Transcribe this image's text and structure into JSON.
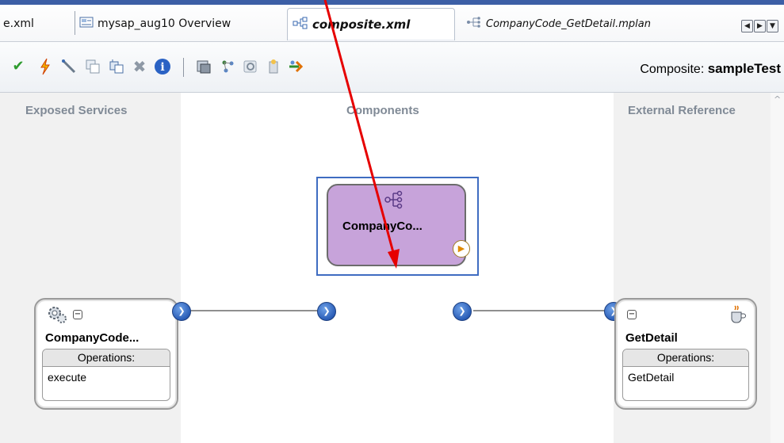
{
  "tabs": [
    {
      "label": "e.xml",
      "icon": "xml-file-icon"
    },
    {
      "label": "mysap_aug10 Overview",
      "icon": "overview-icon"
    },
    {
      "label": "composite.xml",
      "icon": "composite-icon",
      "active": true
    },
    {
      "label": "CompanyCode_GetDetail.mplan",
      "icon": "mplan-icon"
    }
  ],
  "toolbar": {
    "composite_prefix": "Composite:",
    "composite_name": "sampleTest",
    "icons": [
      "validate-check-icon",
      "deploy-lightning-icon",
      "wire-icon",
      "copy-component-icon",
      "paste-component-icon",
      "delete-icon",
      "info-icon",
      "services-icon",
      "layout-icon",
      "refresh-icon",
      "wizard-icon",
      "test-icon"
    ]
  },
  "canvas": {
    "exposed_services": "Exposed Services",
    "components": "Components",
    "external_references": "External Reference"
  },
  "service": {
    "title": "CompanyCode...",
    "operations_header": "Operations:",
    "operations": [
      "execute"
    ]
  },
  "component": {
    "title": "CompanyCo..."
  },
  "reference": {
    "title": "GetDetail",
    "operations_header": "Operations:",
    "operations": [
      "GetDetail"
    ]
  },
  "colors": {
    "component_fill": "#c7a3da",
    "selection_border": "#3f6cc1",
    "annotation_arrow": "#e60000",
    "lane_title": "#808a96"
  }
}
